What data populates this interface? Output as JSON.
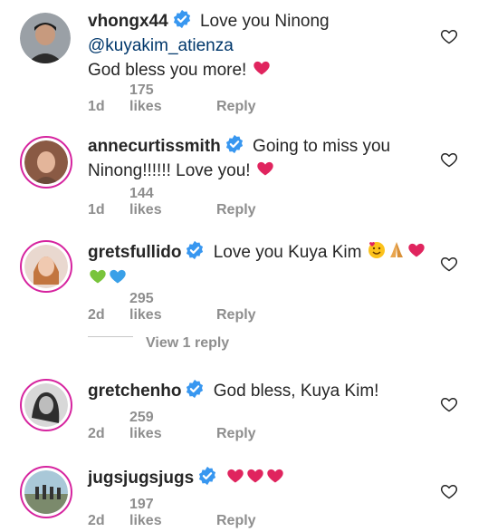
{
  "comments": [
    {
      "username": "vhongx44",
      "text_a": "Love you Ninong",
      "mention": "@kuyakim_atienza",
      "text_b": "God bless you more!",
      "time": "1d",
      "likes": "175 likes",
      "reply": "Reply",
      "emoji": [
        "red-heart"
      ]
    },
    {
      "username": "annecurtissmith",
      "text_a": "Going to miss you",
      "text_b": "Ninong!!!!!! Love you!",
      "time": "1d",
      "likes": "144 likes",
      "reply": "Reply",
      "emoji": [
        "red-heart"
      ]
    },
    {
      "username": "gretsfullido",
      "text_a": "Love you Kuya Kim",
      "time": "2d",
      "likes": "295 likes",
      "reply": "Reply",
      "emoji": [
        "smiling-face-with-hearts",
        "folded-hands",
        "red-heart",
        "green-heart",
        "blue-heart"
      ]
    },
    {
      "username": "gretchenho",
      "text_a": "God bless, Kuya Kim!",
      "time": "2d",
      "likes": "259 likes",
      "reply": "Reply"
    },
    {
      "username": "jugsjugsjugs",
      "time": "2d",
      "likes": "197 likes",
      "reply": "Reply",
      "emoji": [
        "red-heart",
        "red-heart",
        "red-heart"
      ]
    }
  ],
  "view_replies": "View 1 reply",
  "colors": {
    "verified": "#3897f0",
    "meta": "#8e8e8e",
    "mention": "#00376b",
    "heart": "#e0245e"
  }
}
